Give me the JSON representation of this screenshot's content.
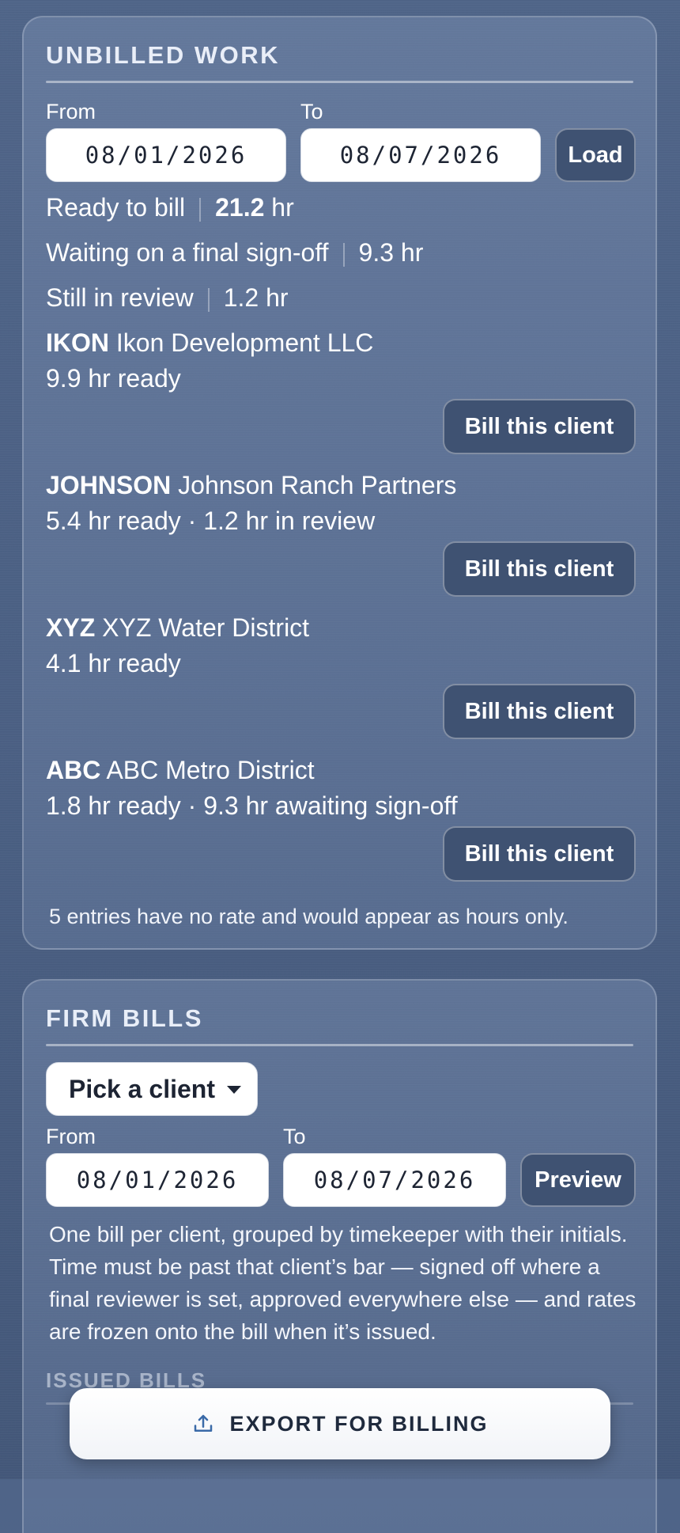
{
  "unbilled": {
    "title": "UNBILLED WORK",
    "from_label": "From",
    "to_label": "To",
    "from_date": "08/01/2026",
    "to_date": "08/07/2026",
    "load_label": "Load",
    "summary": [
      {
        "label": "Ready to bill",
        "value": "21.2",
        "unit": "hr"
      },
      {
        "label": "Waiting on a final sign-off",
        "value": "9.3 hr"
      },
      {
        "label": "Still in review",
        "value": "1.2 hr"
      }
    ],
    "clients": [
      {
        "code": "IKON",
        "name": "Ikon Development LLC",
        "detail": "9.9 hr ready",
        "button": "Bill this client"
      },
      {
        "code": "JOHNSON",
        "name": "Johnson Ranch Partners",
        "detail": "5.4 hr ready · 1.2 hr in review",
        "button": "Bill this client"
      },
      {
        "code": "XYZ",
        "name": "XYZ Water District",
        "detail": "4.1 hr ready",
        "button": "Bill this client"
      },
      {
        "code": "ABC",
        "name": "ABC Metro District",
        "detail": "1.8 hr ready · 9.3 hr awaiting sign-off",
        "button": "Bill this client"
      }
    ],
    "note": "5 entries have no rate and would appear as hours only."
  },
  "firm": {
    "title": "FIRM BILLS",
    "client_select": "Pick a client",
    "from_label": "From",
    "to_label": "To",
    "from_date": "08/01/2026",
    "to_date": "08/07/2026",
    "preview_label": "Preview",
    "description": "One bill per client, grouped by timekeeper with their initials. Time must be past that client’s bar — signed off where a final reviewer is set, approved everywhere else — and rates are frozen onto the bill when it’s issued.",
    "issued_title": "ISSUED BILLS"
  },
  "export": {
    "label": "EXPORT FOR BILLING",
    "icon": "upload-icon"
  }
}
